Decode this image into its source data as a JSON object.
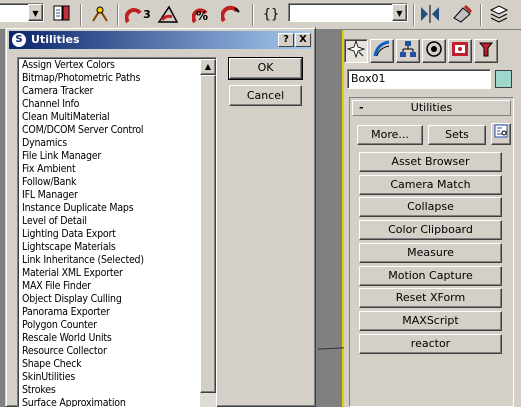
{
  "toolbar": {
    "icons": [
      "selection-filter-dropdown",
      "select-by-name-icon",
      "snap-toggle-icon",
      "angle-snap-icon",
      "percent-snap-icon",
      "spinner-snap-icon",
      "edit-named-selection-icon",
      "named-selection-dropdown",
      "mirror-icon",
      "align-icon",
      "layer-manager-icon"
    ],
    "angle_snap_label": "3",
    "percent_label": "%",
    "align_label": "{}"
  },
  "command_panel": {
    "tabs": [
      "create-tab",
      "modify-tab",
      "hierarchy-tab",
      "motion-tab",
      "display-tab",
      "utilities-tab"
    ],
    "object_name": "Box01",
    "object_color": "#9ed8cd",
    "rollout": {
      "title": "Utilities",
      "collapse_symbol": "-",
      "more_label": "More...",
      "sets_label": "Sets",
      "buttons": [
        "Asset Browser",
        "Camera Match",
        "Collapse",
        "Color Clipboard",
        "Measure",
        "Motion Capture",
        "Reset XForm",
        "MAXScript",
        "reactor"
      ]
    }
  },
  "dialog": {
    "title": "Utilities",
    "help_label": "?",
    "close_label": "X",
    "ok_label": "OK",
    "cancel_label": "Cancel",
    "items": [
      "Assign Vertex Colors",
      "Bitmap/Photometric Paths",
      "Camera Tracker",
      "Channel Info",
      "Clean MultiMaterial",
      "COM/DCOM Server Control",
      "Dynamics",
      "File Link Manager",
      "Fix Ambient",
      "Follow/Bank",
      "IFL Manager",
      "Instance Duplicate Maps",
      "Level of Detail",
      "Lighting Data Export",
      "Lightscape Materials",
      "Link Inheritance (Selected)",
      "Material XML Exporter",
      "MAX File Finder",
      "Object Display Culling",
      "Panorama Exporter",
      "Polygon Counter",
      "Rescale World Units",
      "Resource Collector",
      "Shape Check",
      "SkinUtilities",
      "Strokes",
      "Surface Approximation"
    ]
  }
}
